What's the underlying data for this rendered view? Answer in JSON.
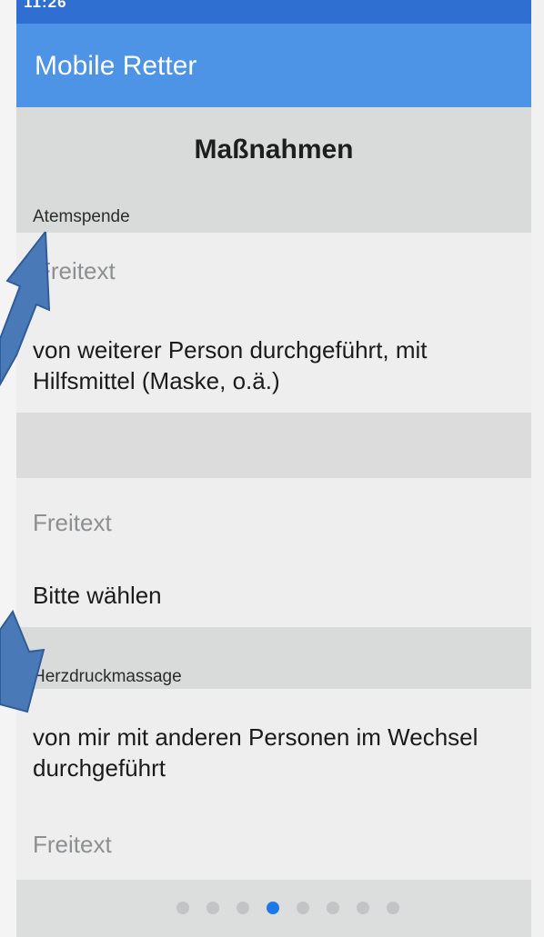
{
  "status_bar": {
    "time": "11:26"
  },
  "app_bar": {
    "title": "Mobile Retter"
  },
  "page": {
    "heading": "Maßnahmen"
  },
  "sections": [
    {
      "label": "Atemspende",
      "freetext_placeholder": "Freitext",
      "selected_value": "von weiterer Person durchgeführt, mit Hilfsmittel (Maske, o.ä.)"
    },
    {
      "label": "",
      "freetext_placeholder": "Freitext",
      "selected_value": "Bitte wählen"
    },
    {
      "label": "Herzdruckmassage",
      "selected_value": "von mir mit anderen Personen im Wechsel durchgeführt",
      "freetext_placeholder": "Freitext"
    }
  ],
  "pager": {
    "total": 8,
    "active_index": 3
  },
  "colors": {
    "status_bar": "#2f6fd1",
    "app_bar": "#4d93e6",
    "pager_active": "#1f78e6",
    "arrow_annotation": "#4a79b7"
  }
}
